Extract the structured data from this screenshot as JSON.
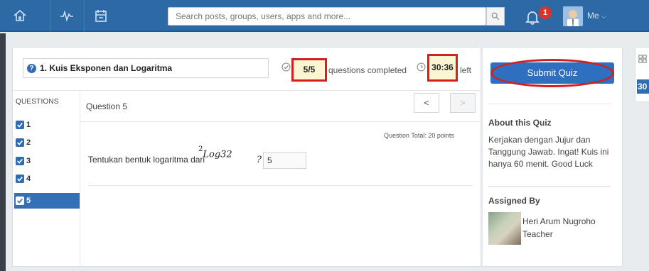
{
  "nav": {
    "search_placeholder": "Search posts, groups, users, apps and more...",
    "notifications_count": "1",
    "user_label": "Me"
  },
  "quiz": {
    "title": "1. Kuis Eksponen dan Logaritma",
    "progress": "5/5",
    "progress_label": "questions completed",
    "time_left": "30:36",
    "time_label": "left"
  },
  "questions": {
    "header": "QUESTIONS",
    "items": [
      "1",
      "2",
      "3",
      "4",
      "5"
    ],
    "active": "5"
  },
  "current": {
    "label": "Question 5",
    "prev": "<",
    "next": ">",
    "total": "Question Total: 20 points",
    "text": "Tentukan bentuk logaritma dari",
    "math_sup": "2",
    "math_expr": "Log32",
    "qmark": "?",
    "answer_value": "5"
  },
  "sidebar": {
    "submit_label": "Submit Quiz",
    "about_title": "About this Quiz",
    "about_text": "Kerjakan dengan Jujur dan Tanggung Jawab. Ingat! Kuis ini hanya 60 menit. Good Luck",
    "assigned_title": "Assigned By",
    "teacher_name": "Heri Arum Nugroho",
    "teacher_role": "Teacher"
  },
  "widget": {
    "calendar_text": "30"
  },
  "colors": {
    "nav_blue": "#2d6aa5",
    "accent_blue": "#2e6fbf",
    "highlight_red": "#d21f1f"
  }
}
